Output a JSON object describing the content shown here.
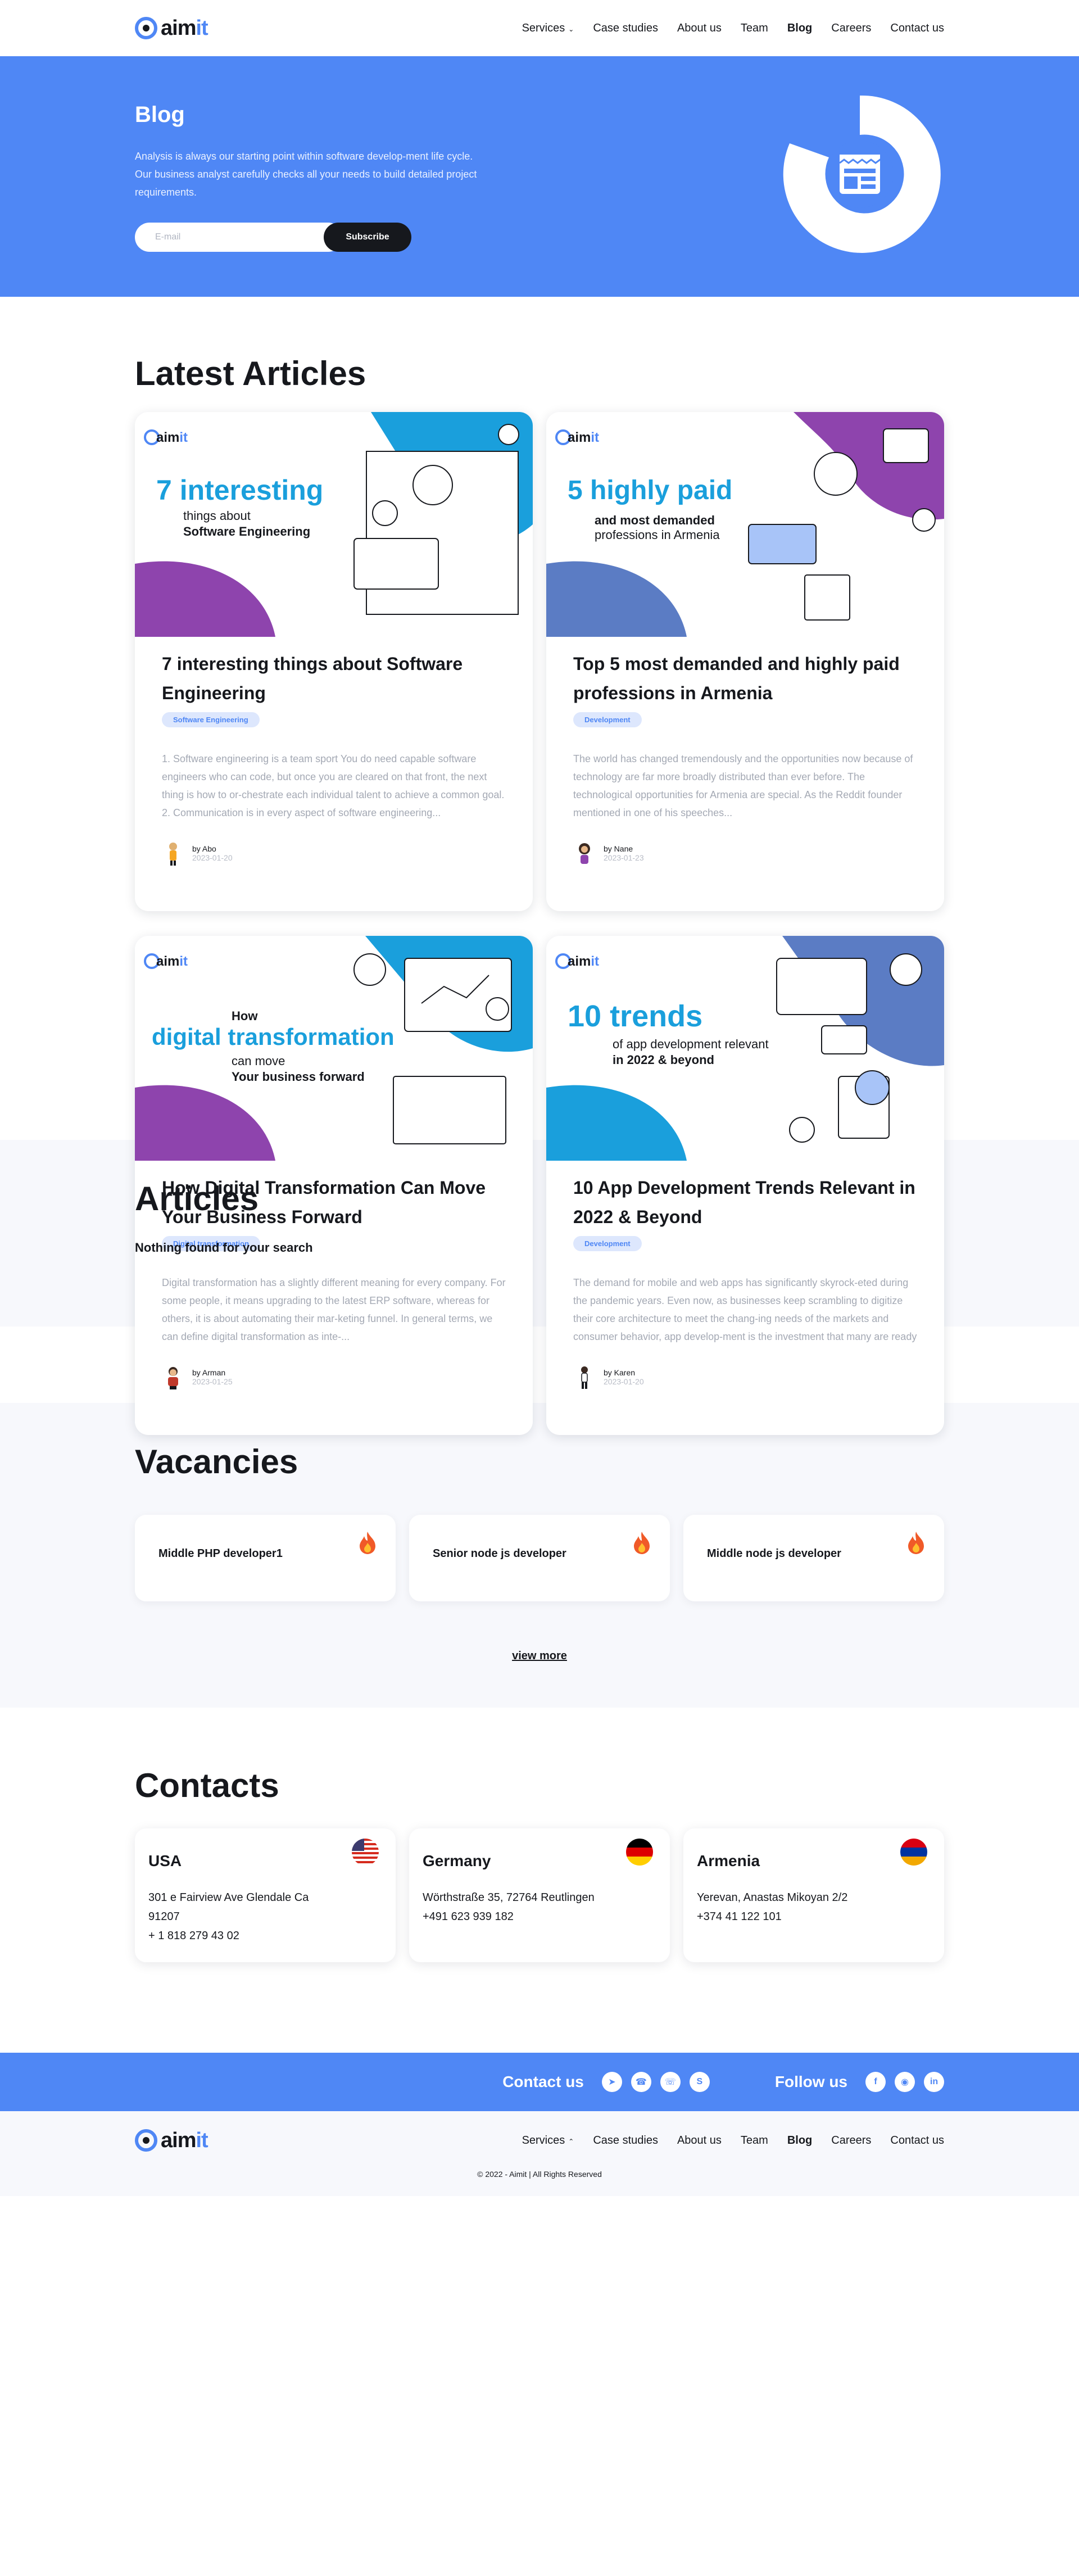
{
  "header": {
    "logo": {
      "aim": "aim",
      "it": "it"
    },
    "nav": [
      {
        "label": "Services",
        "active": false,
        "has_dropdown": true
      },
      {
        "label": "Case studies",
        "active": false
      },
      {
        "label": "About us",
        "active": false
      },
      {
        "label": "Team",
        "active": false
      },
      {
        "label": "Blog",
        "active": true
      },
      {
        "label": "Careers",
        "active": false
      },
      {
        "label": "Contact us",
        "active": false
      }
    ]
  },
  "hero": {
    "title": "Blog",
    "description": "Analysis is always our starting point within software develop-ment life cycle. Our business analyst carefully checks all your needs to build detailed project requirements.",
    "email_placeholder": "E-mail",
    "subscribe_label": "Subscribe",
    "icon": "newspaper-icon"
  },
  "latest": {
    "title": "Latest Articles",
    "articles": [
      {
        "banner": {
          "big": "7 interesting",
          "line2": "things about",
          "line3": "Software Engineering"
        },
        "title": "7 interesting things about Software Engineering",
        "tag": "Software Engineering",
        "excerpt": "1. Software engineering is a team sport You do need capable software engineers who can code, but once you are cleared on that front, the next thing is how to or-chestrate each individual talent to achieve a common goal. 2. Communication is in every aspect of software engineering...",
        "author": "by Abo",
        "date": "2023-01-20"
      },
      {
        "banner": {
          "big": "5 highly paid",
          "line2": "and most demanded",
          "line3": "professions in Armenia"
        },
        "title": "Top 5 most demanded and highly paid professions in Armenia",
        "tag": "Development",
        "excerpt": "The world has changed tremendously and the opportunities now because of technology are far more broadly distributed than ever before. The technological opportunities for Armenia are special. As the Reddit founder mentioned in one of his speeches...",
        "author": "by Nane",
        "date": "2023-01-23"
      },
      {
        "banner": {
          "small": "How",
          "big": "digital transformation",
          "line2": "can move",
          "line3": "Your business forward"
        },
        "title": "How Digital Transformation Can Move Your Business Forward",
        "tag": "Digital transformation",
        "excerpt": "Digital transformation has a slightly different meaning for every company. For some people, it means upgrading to the latest ERP software, whereas for others, it is about automating their mar-keting funnel. In general terms, we can define digital transformation as inte-...",
        "author": "by Arman",
        "date": "2023-01-25"
      },
      {
        "banner": {
          "big": "10 trends",
          "line2": "of app development relevant",
          "line3": "in 2022 & beyond"
        },
        "title": "10 App Development Trends Relevant in 2022 & Beyond",
        "tag": "Development",
        "excerpt": "The demand for mobile and web apps has significantly skyrock-eted during the pandemic years. Even now, as businesses keep scrambling to digitize their core architecture to meet the chang-ing needs of the markets and consumer behavior, app develop-ment is the investment that many are ready to make...",
        "author": "by Karen",
        "date": "2023-01-20"
      }
    ]
  },
  "articles_section": {
    "title": "Articles",
    "empty_text": "Nothing found for your search"
  },
  "vacancies": {
    "title": "Vacancies",
    "items": [
      {
        "title": "Middle PHP developer1"
      },
      {
        "title": "Senior node js developer"
      },
      {
        "title": "Middle node js developer"
      }
    ],
    "view_more": "view more"
  },
  "contacts": {
    "title": "Contacts",
    "items": [
      {
        "country": "USA",
        "line1": "301 e Fairview Ave Glendale Ca",
        "line2": "91207",
        "line3": "+ 1 818 279 43 02",
        "flag": "us-flag-icon"
      },
      {
        "country": "Germany",
        "line1": "Wörthstraße 35, 72764 Reutlingen",
        "line2": "+491 623 939 182",
        "line3": "",
        "flag": "de-flag-icon"
      },
      {
        "country": "Armenia",
        "line1": "Yerevan, Anastas Mikoyan 2/2",
        "line2": "+374 41 122 101",
        "line3": "",
        "flag": "am-flag-icon"
      }
    ]
  },
  "follow_bar": {
    "contact_label": "Contact us",
    "follow_label": "Follow us",
    "contact_icons": [
      "telegram-icon",
      "whatsapp-icon",
      "viber-icon",
      "skype-icon"
    ],
    "follow_icons": [
      "facebook-icon",
      "instagram-icon",
      "linkedin-icon"
    ]
  },
  "footer": {
    "copyright": "© 2022 - Aimit | All Rights Reserved"
  },
  "colors": {
    "brand_blue": "#4f87f5",
    "dark": "#16181d",
    "purple": "#8e44ad",
    "cyan": "#1a9fdc"
  }
}
